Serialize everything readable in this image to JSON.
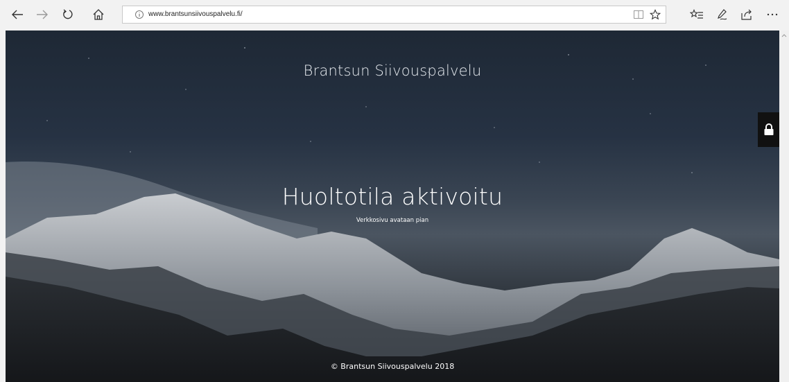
{
  "browser": {
    "url": "www.brantsunsiivouspalvelu.fi/",
    "icons": {
      "back": "arrow-left-icon",
      "forward": "arrow-right-icon",
      "refresh": "refresh-icon",
      "home": "home-icon",
      "info": "info-icon",
      "reading_view": "reading-view-icon",
      "favorite": "star-icon",
      "favorites_hub": "favorites-list-icon",
      "notes": "pen-icon",
      "share": "share-icon",
      "more": "more-icon"
    }
  },
  "page": {
    "site_title": "Brantsun Siivouspalvelu",
    "headline": "Huoltotila aktivoitu",
    "subline": "Verkkosivu avataan pian",
    "footer": "© Brantsun Siivouspalvelu 2018",
    "lock_icon": "lock-icon"
  },
  "colors": {
    "toolbar_bg": "#f2f2f2",
    "sky_top": "#1e2835",
    "text": "#ffffff"
  }
}
